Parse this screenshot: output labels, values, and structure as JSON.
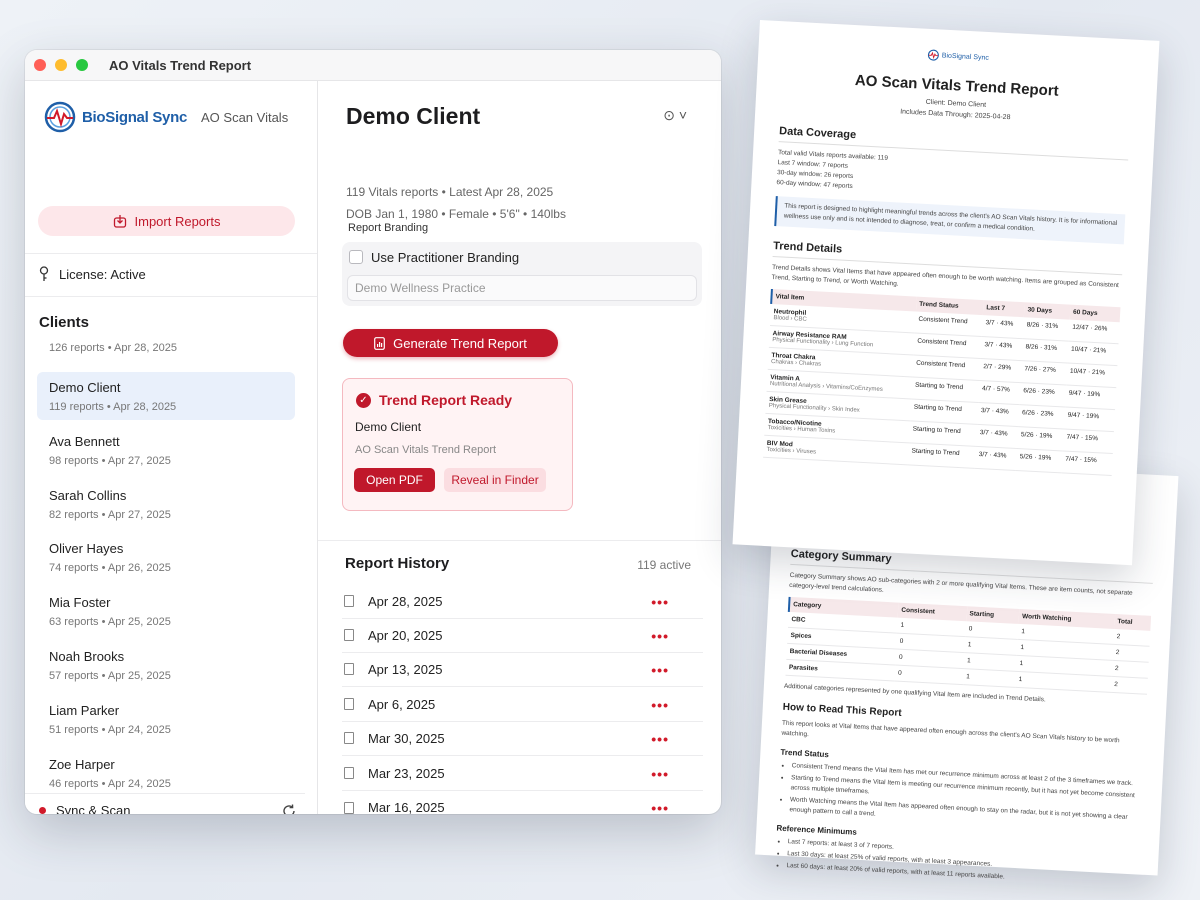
{
  "window": {
    "title": "AO Vitals Trend Report"
  },
  "sidebar": {
    "brand_name": "BioSignal Sync",
    "brand_sub": "AO Scan Vitals",
    "import_label": "Import Reports",
    "license": "License: Active",
    "clients_heading": "Clients",
    "clients_summary": "126 reports • Apr 28, 2025",
    "clients": [
      {
        "name": "Demo Client",
        "sub": "119 reports • Apr 28, 2025",
        "selected": true
      },
      {
        "name": "Ava Bennett",
        "sub": "98 reports • Apr 27, 2025"
      },
      {
        "name": "Sarah Collins",
        "sub": "82 reports • Apr 27, 2025"
      },
      {
        "name": "Oliver Hayes",
        "sub": "74 reports • Apr 26, 2025"
      },
      {
        "name": "Mia Foster",
        "sub": "63 reports • Apr 25, 2025"
      },
      {
        "name": "Noah Brooks",
        "sub": "57 reports • Apr 25, 2025"
      },
      {
        "name": "Liam Parker",
        "sub": "51 reports • Apr 24, 2025"
      },
      {
        "name": "Zoe Harper",
        "sub": "46 reports • Apr 24, 2025"
      }
    ],
    "sync_label": "Sync & Scan"
  },
  "main": {
    "client_name": "Demo Client",
    "meta_line1": "119 Vitals reports • Latest Apr 28, 2025",
    "meta_line2": "DOB Jan 1, 1980 • Female • 5'6\" • 140lbs",
    "branding_label": "Report Branding",
    "use_branding_label": "Use Practitioner Branding",
    "practice_placeholder": "Demo Wellness Practice",
    "generate_label": "Generate Trend Report",
    "ready_title": "Trend Report Ready",
    "ready_client": "Demo Client",
    "ready_subtitle": "AO Scan Vitals Trend Report",
    "open_pdf_label": "Open PDF",
    "reveal_label": "Reveal in Finder",
    "history_title": "Report History",
    "history_count": "119 active",
    "history": [
      "Apr 28, 2025",
      "Apr 20, 2025",
      "Apr 13, 2025",
      "Apr 6, 2025",
      "Mar 30, 2025",
      "Mar 23, 2025",
      "Mar 16, 2025"
    ]
  },
  "report_page1": {
    "logo_text": "BioSignal Sync",
    "title": "AO Scan Vitals Trend Report",
    "client_line": "Client: Demo Client",
    "through_line": "Includes Data Through: 2025-04-28",
    "coverage_heading": "Data Coverage",
    "coverage_lines": [
      "Total valid Vitals reports available: 119",
      "Last 7 window: 7 reports",
      "30-day window: 26 reports",
      "60-day window: 47 reports"
    ],
    "note": "This report is designed to highlight meaningful trends across the client's AO Scan Vitals history. It is for informational wellness use only and is not intended to diagnose, treat, or confirm a medical condition.",
    "trend_heading": "Trend Details",
    "trend_intro": "Trend Details shows Vital Items that have appeared often enough to be worth watching. Items are grouped as Consistent Trend, Starting to Trend, or Worth Watching.",
    "table_headers": [
      "Vital Item",
      "Trend Status",
      "Last 7",
      "30 Days",
      "60 Days"
    ],
    "rows": [
      {
        "name": "Neutrophil",
        "path": "Blood › CBC",
        "status": "Consistent Trend",
        "l7": "3/7 · 43%",
        "d30": "8/26 · 31%",
        "d60": "12/47 · 26%"
      },
      {
        "name": "Airway Resistance RAM",
        "path": "Physical Functionality › Lung Function",
        "status": "Consistent Trend",
        "l7": "3/7 · 43%",
        "d30": "8/26 · 31%",
        "d60": "10/47 · 21%"
      },
      {
        "name": "Throat Chakra",
        "path": "Chakras › Chakras",
        "status": "Consistent Trend",
        "l7": "2/7 · 29%",
        "d30": "7/26 · 27%",
        "d60": "10/47 · 21%"
      },
      {
        "name": "Vitamin A",
        "path": "Nutritional Analysis › Vitamins/CoEnzymes",
        "status": "Starting to Trend",
        "l7": "4/7 · 57%",
        "d30": "6/26 · 23%",
        "d60": "9/47 · 19%"
      },
      {
        "name": "Skin Grease",
        "path": "Physical Functionality › Skin Index",
        "status": "Starting to Trend",
        "l7": "3/7 · 43%",
        "d30": "6/26 · 23%",
        "d60": "9/47 · 19%"
      },
      {
        "name": "Tobacco/Nicotine",
        "path": "Toxicities › Human Toxins",
        "status": "Starting to Trend",
        "l7": "3/7 · 43%",
        "d30": "5/26 · 19%",
        "d60": "7/47 · 15%"
      },
      {
        "name": "BIV Mod",
        "path": "Toxicities › Viruses",
        "status": "Starting to Trend",
        "l7": "3/7 · 43%",
        "d30": "5/26 · 19%",
        "d60": "7/47 · 15%"
      }
    ]
  },
  "report_page2": {
    "cat_heading": "Category Summary",
    "cat_intro": "Category Summary shows AO sub-categories with 2 or more qualifying Vital Items. These are item counts, not separate category-level trend calculations.",
    "cat_headers": [
      "Category",
      "Consistent",
      "Starting",
      "Worth Watching",
      "Total"
    ],
    "cat_rows": [
      [
        "CBC",
        "1",
        "0",
        "1",
        "2"
      ],
      [
        "Spices",
        "0",
        "1",
        "1",
        "2"
      ],
      [
        "Bacterial Diseases",
        "0",
        "1",
        "1",
        "2"
      ],
      [
        "Parasites",
        "0",
        "1",
        "1",
        "2"
      ]
    ],
    "cat_note": "Additional categories represented by one qualifying Vital Item are included in Trend Details.",
    "how_heading": "How to Read This Report",
    "how_intro": "This report looks at Vital Items that have appeared often enough across the client's AO Scan Vitals history to be worth watching.",
    "status_heading": "Trend Status",
    "status_items": [
      "Consistent Trend means the Vital Item has met our recurrence minimum across at least 2 of the 3 timeframes we track.",
      "Starting to Trend means the Vital Item is meeting our recurrence minimum recently, but it has not yet become consistent across multiple timeframes.",
      "Worth Watching means the Vital Item has appeared often enough to stay on the radar, but it is not yet showing a clear enough pattern to call a trend."
    ],
    "min_heading": "Reference Minimums",
    "min_items": [
      "Last 7 reports: at least 3 of 7 reports.",
      "Last 30 days: at least 25% of valid reports, with at least 3 appearances.",
      "Last 60 days: at least 20% of valid reports, with at least 11 reports available."
    ]
  }
}
